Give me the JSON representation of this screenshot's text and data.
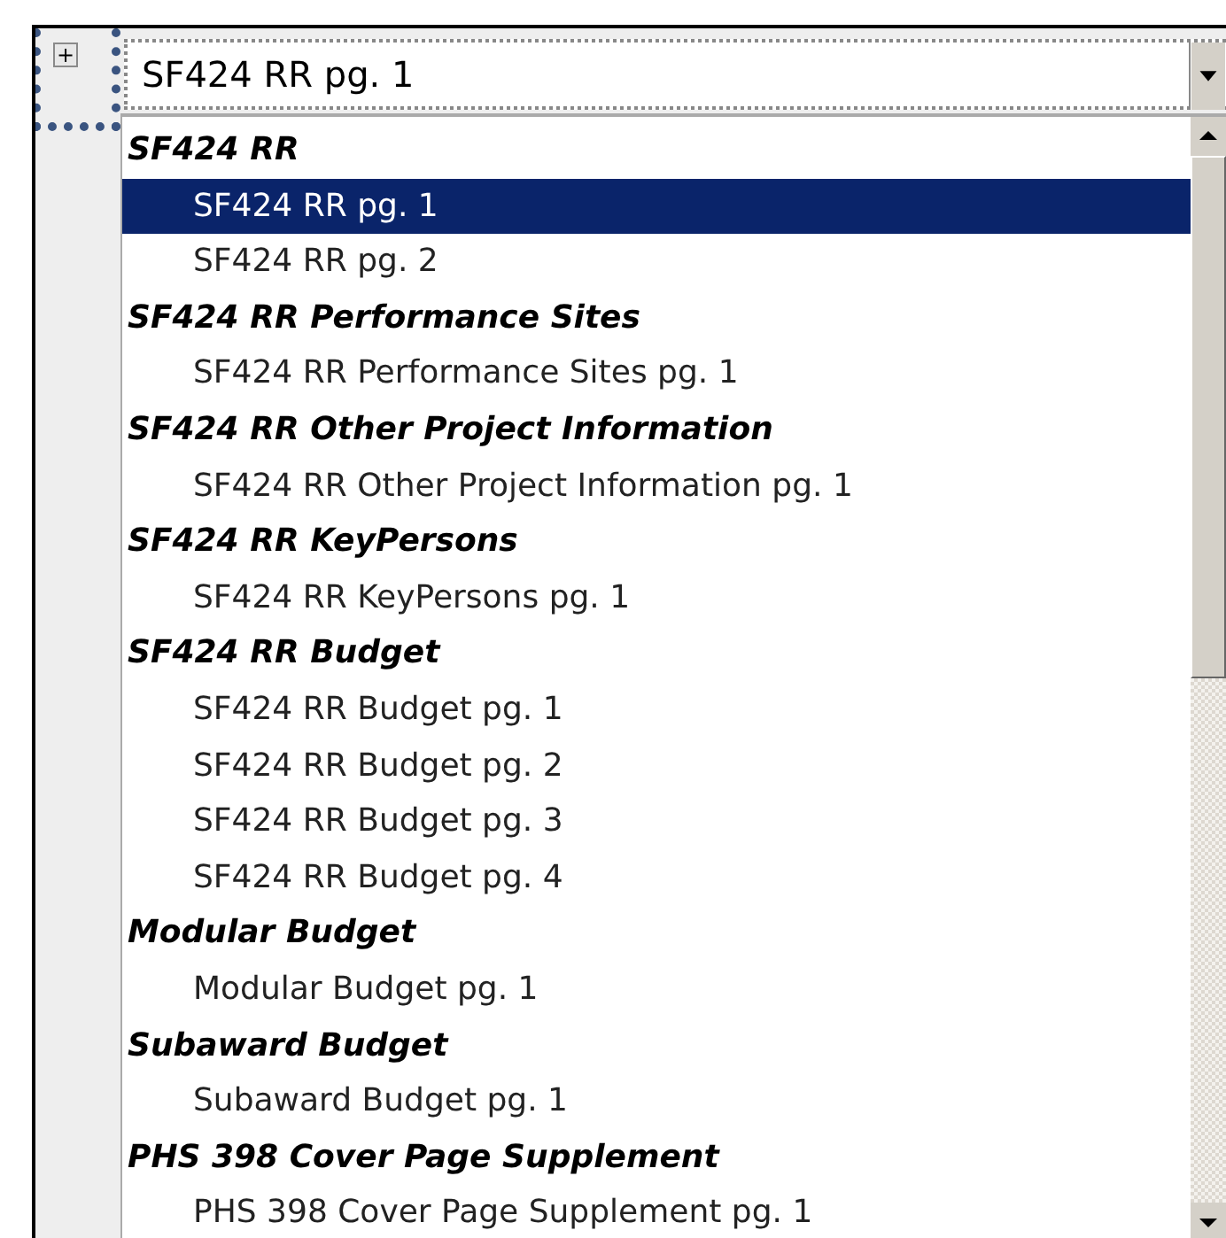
{
  "expand_button": {
    "label": "+"
  },
  "combo": {
    "value": "SF424 RR pg. 1"
  },
  "groups": [
    {
      "label": "SF424 RR",
      "children": [
        {
          "label": "SF424 RR pg. 1",
          "selected": true
        },
        {
          "label": "SF424 RR pg. 2",
          "selected": false
        }
      ]
    },
    {
      "label": "SF424 RR Performance Sites",
      "children": [
        {
          "label": "SF424 RR Performance Sites pg. 1",
          "selected": false
        }
      ]
    },
    {
      "label": "SF424 RR Other Project Information",
      "children": [
        {
          "label": "SF424 RR Other Project Information pg. 1",
          "selected": false
        }
      ]
    },
    {
      "label": "SF424 RR KeyPersons",
      "children": [
        {
          "label": "SF424 RR KeyPersons pg. 1",
          "selected": false
        }
      ]
    },
    {
      "label": "SF424 RR Budget",
      "children": [
        {
          "label": "SF424 RR Budget pg. 1",
          "selected": false
        },
        {
          "label": "SF424 RR Budget pg. 2",
          "selected": false
        },
        {
          "label": "SF424 RR Budget pg. 3",
          "selected": false
        },
        {
          "label": "SF424 RR Budget pg. 4",
          "selected": false
        }
      ]
    },
    {
      "label": "Modular Budget",
      "children": [
        {
          "label": "Modular Budget pg. 1",
          "selected": false
        }
      ]
    },
    {
      "label": "Subaward Budget",
      "children": [
        {
          "label": "Subaward Budget pg. 1",
          "selected": false
        }
      ]
    },
    {
      "label": "PHS 398 Cover Page Supplement",
      "children": [
        {
          "label": "PHS 398 Cover Page Supplement pg. 1",
          "selected": false
        }
      ]
    }
  ]
}
